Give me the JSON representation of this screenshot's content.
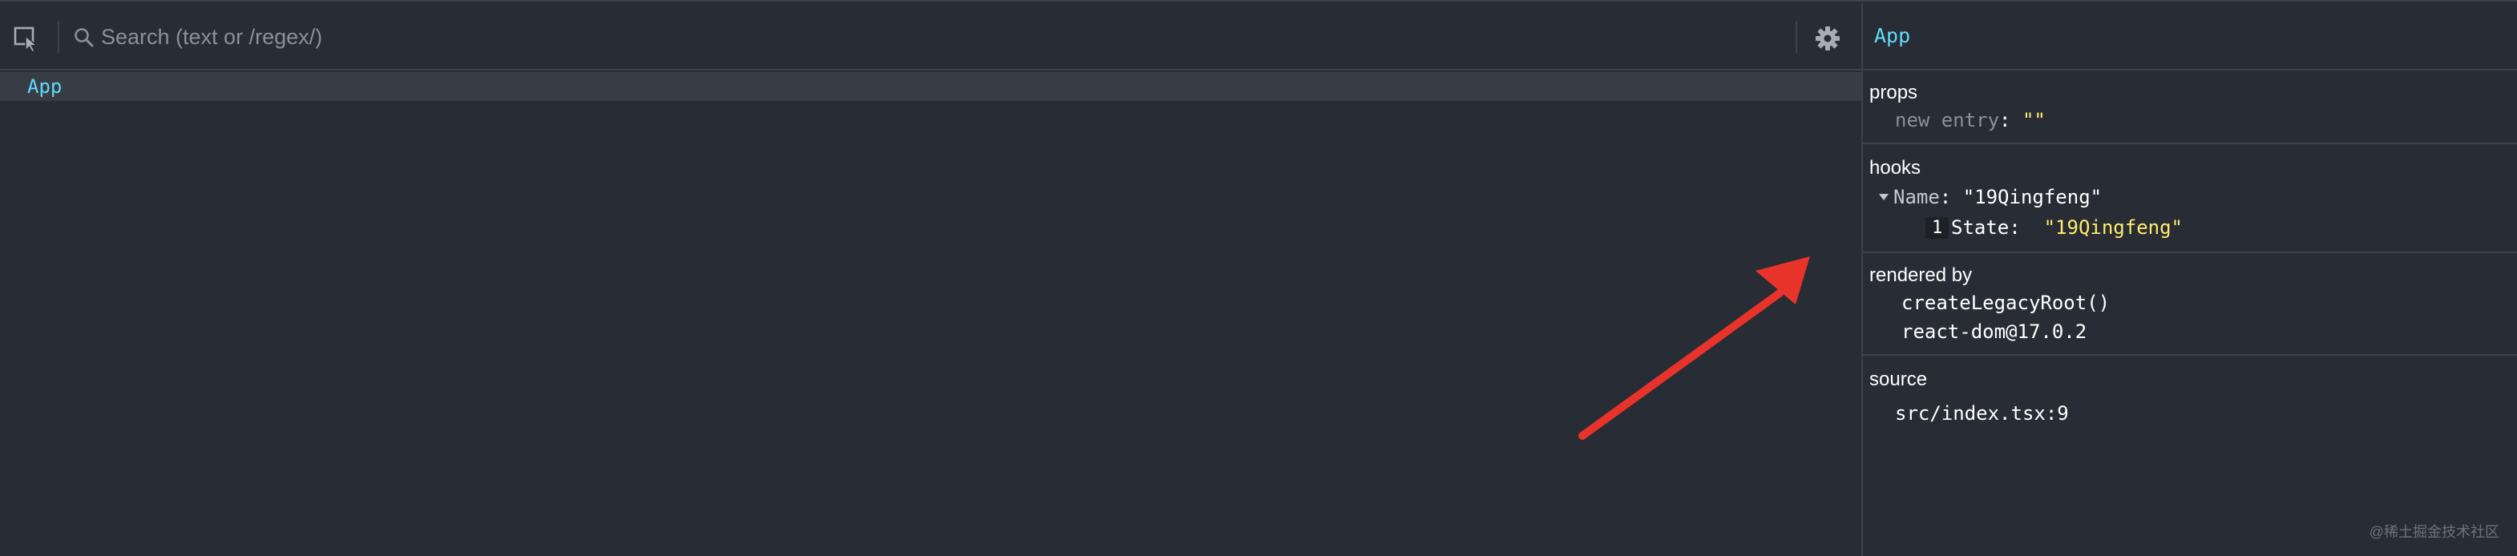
{
  "toolbar": {
    "search_placeholder": "Search (text or /regex/)",
    "inspect_icon": "select-element-icon",
    "search_icon": "search-icon",
    "settings_icon": "gear-icon"
  },
  "tree": {
    "rows": [
      {
        "label": "App",
        "selected": true
      }
    ]
  },
  "inspector": {
    "title": "App",
    "props": {
      "heading": "props",
      "new_entry_key": "new entry",
      "new_entry_value": "\"\""
    },
    "hooks": {
      "heading": "hooks",
      "name_key": "Name",
      "name_value": "\"19Qingfeng\"",
      "state_index": "1",
      "state_key": "State",
      "state_value": "\"19Qingfeng\""
    },
    "rendered_by": {
      "heading": "rendered by",
      "items": [
        "createLegacyRoot()",
        "react-dom@17.0.2"
      ]
    },
    "source": {
      "heading": "source",
      "file": "src/index.tsx:9"
    }
  },
  "annotation": {
    "arrow_color": "#e8332a"
  },
  "colors": {
    "background": "#282c34",
    "border": "#3d424b",
    "component_name": "#61dafb",
    "string_value": "#ffec6e",
    "selected_row": "#373c45"
  },
  "watermark": "@稀土掘金技术社区"
}
